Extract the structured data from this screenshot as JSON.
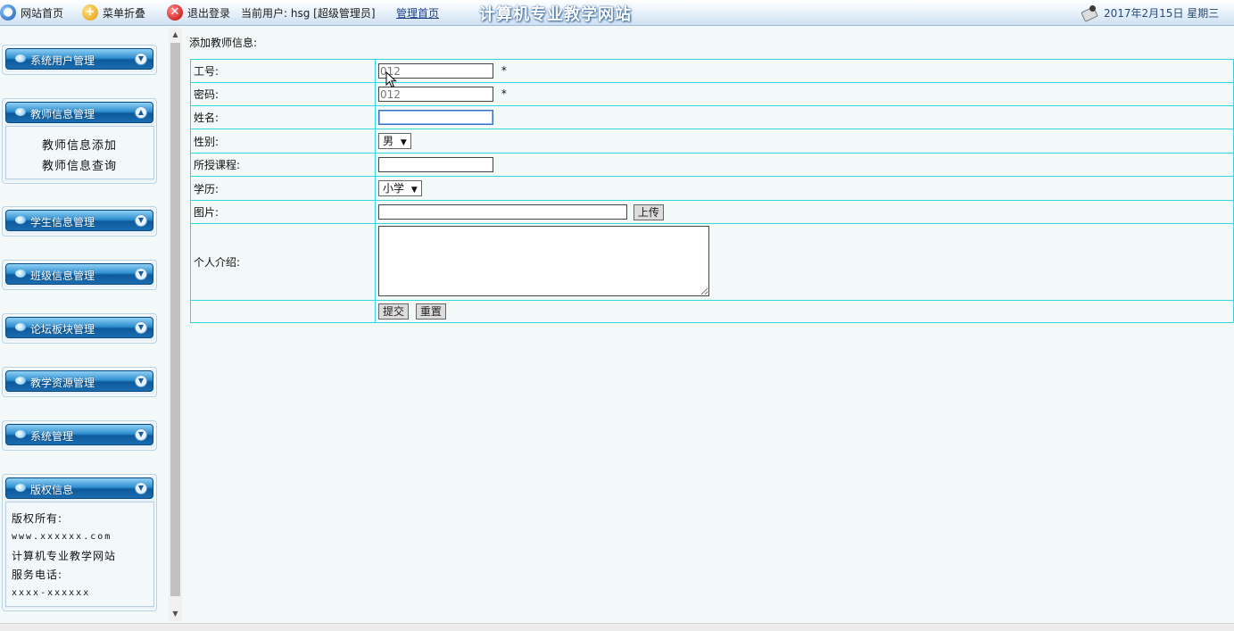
{
  "topbar": {
    "home_link": "网站首页",
    "collapse_menu": "菜单折叠",
    "logout": "退出登录",
    "current_user": "当前用户: hsg [超级管理员]",
    "admin_home": "管理首页",
    "site_title": "计算机专业教学网站",
    "date": "2017年2月15日 星期三"
  },
  "sidebar": {
    "menus": [
      {
        "label": "系统用户管理",
        "expanded": false
      },
      {
        "label": "教师信息管理",
        "expanded": true,
        "items": [
          "教师信息添加",
          "教师信息查询"
        ]
      },
      {
        "label": "学生信息管理",
        "expanded": false
      },
      {
        "label": "班级信息管理",
        "expanded": false
      },
      {
        "label": "论坛板块管理",
        "expanded": false
      },
      {
        "label": "教学资源管理",
        "expanded": false
      },
      {
        "label": "系统管理",
        "expanded": false
      },
      {
        "label": "版权信息",
        "expanded": true
      }
    ],
    "copyright": {
      "owner_label": "版权所有:",
      "website": "www.xxxxxx.com",
      "site_name": "计算机专业教学网站",
      "phone_label": "服务电话:",
      "phone": "xxxx-xxxxxx"
    }
  },
  "main": {
    "title": "添加教师信息:",
    "form": {
      "teacher_id": {
        "label": "工号:",
        "value": "012",
        "required": "*"
      },
      "password": {
        "label": "密码:",
        "value": "012",
        "required": "*"
      },
      "name": {
        "label": "姓名:",
        "value": ""
      },
      "gender": {
        "label": "性别:",
        "selected": "男"
      },
      "course": {
        "label": "所授课程:",
        "value": ""
      },
      "education": {
        "label": "学历:",
        "selected": "小学"
      },
      "photo": {
        "label": "图片:",
        "value": "",
        "upload_button": "上传"
      },
      "intro": {
        "label": "个人介绍:",
        "value": ""
      },
      "submit_button": "提交",
      "reset_button": "重置"
    }
  },
  "colors": {
    "table_border": "#2fd7e6",
    "menu_header": "#1a6db0",
    "page_bg": "#f3f8f8"
  }
}
